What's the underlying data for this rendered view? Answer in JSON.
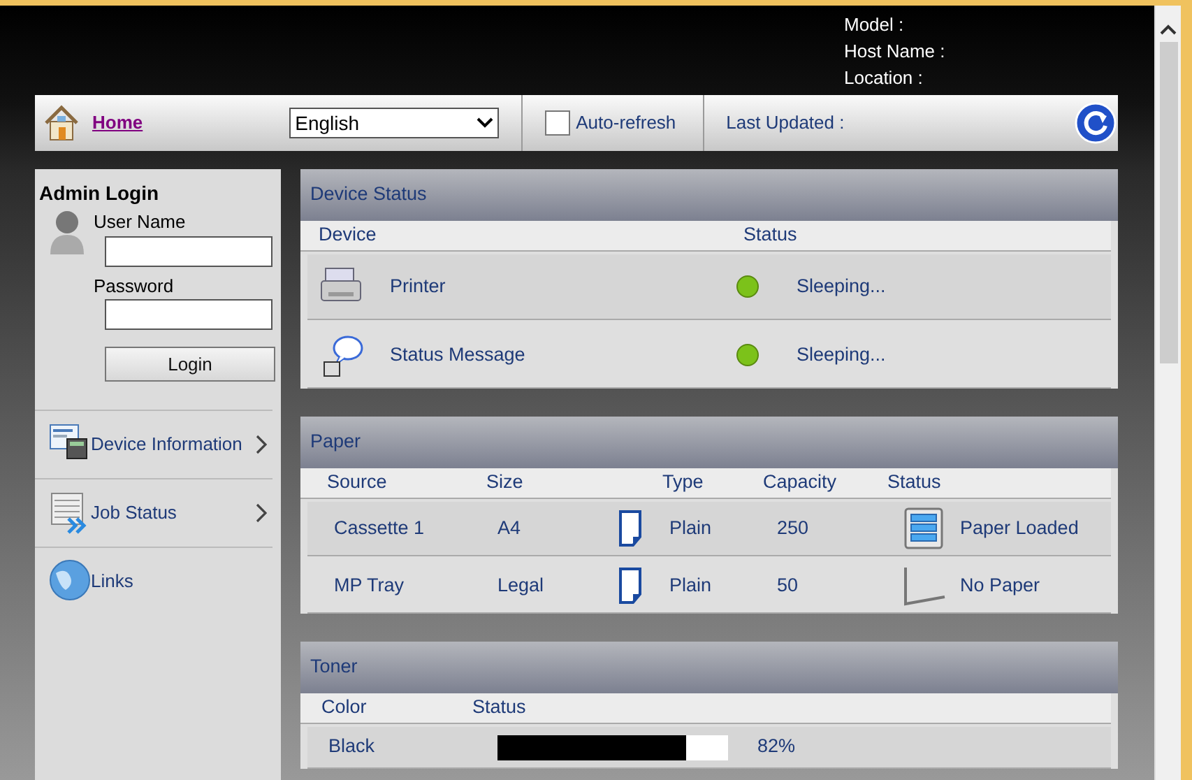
{
  "header": {
    "info": [
      {
        "label": "Model :"
      },
      {
        "label": "Host Name :"
      },
      {
        "label": "Location :"
      }
    ]
  },
  "toolbar": {
    "home": "Home",
    "language": "English",
    "auto_refresh": {
      "label": "Auto-refresh",
      "checked": false
    },
    "last_updated": "Last Updated :"
  },
  "sidebar": {
    "title": "Admin Login",
    "user_label": "User Name",
    "password_label": "Password",
    "login_button": "Login",
    "items": [
      {
        "kind": "device",
        "label": "Device Information",
        "arrow": true
      },
      {
        "kind": "jobs",
        "label": "Job Status",
        "arrow": true
      },
      {
        "kind": "links",
        "label": "Links",
        "arrow": false
      }
    ]
  },
  "device_status": {
    "title": "Device Status",
    "columns": [
      "Device",
      "Status"
    ],
    "rows": [
      {
        "kind": "printer",
        "name": "Printer",
        "color": "#7cc21a",
        "status": "Sleeping..."
      },
      {
        "kind": "message",
        "name": "Status Message",
        "color": "#7cc21a",
        "status": "Sleeping..."
      }
    ]
  },
  "paper": {
    "title": "Paper",
    "columns": [
      "Source",
      "Size",
      "Type",
      "Capacity",
      "Status"
    ],
    "rows": [
      {
        "source": "Cassette 1",
        "size": "A4",
        "type": "Plain",
        "capacity": "250",
        "kind": "loaded",
        "status": "Paper Loaded"
      },
      {
        "source": "MP Tray",
        "size": "Legal",
        "type": "Plain",
        "capacity": "50",
        "kind": "empty",
        "status": "No Paper"
      }
    ]
  },
  "toner": {
    "title": "Toner",
    "columns": [
      "Color",
      "Status"
    ],
    "rows": [
      {
        "name": "Black",
        "level": 0.82,
        "reading": "82%"
      }
    ]
  }
}
